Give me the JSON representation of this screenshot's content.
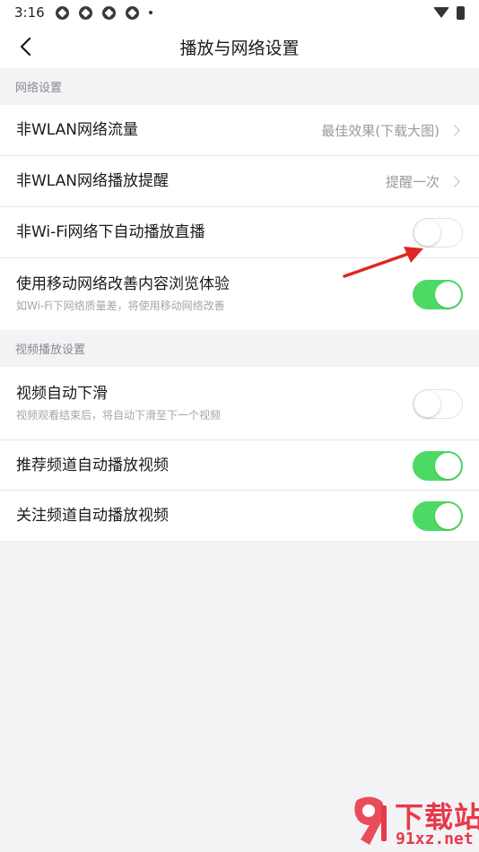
{
  "status_bar": {
    "time": "3:16"
  },
  "header": {
    "title": "播放与网络设置"
  },
  "network_section": {
    "heading": "网络设置",
    "items": [
      {
        "label": "非WLAN网络流量",
        "value": "最佳效果(下载大图)"
      },
      {
        "label": "非WLAN网络播放提醒",
        "value": "提醒一次"
      },
      {
        "label": "非Wi-Fi网络下自动播放直播",
        "toggle": false
      },
      {
        "label": "使用移动网络改善内容浏览体验",
        "sub": "如Wi-Fi下网络质量差，将使用移动网络改善",
        "toggle": true
      }
    ]
  },
  "video_section": {
    "heading": "视频播放设置",
    "items": [
      {
        "label": "视频自动下滑",
        "sub": "视频观看结束后，将自动下滑至下一个视频",
        "toggle": false
      },
      {
        "label": "推荐频道自动播放视频",
        "toggle": true
      },
      {
        "label": "关注频道自动播放视频",
        "toggle": true
      }
    ]
  },
  "watermark": {
    "brand": "下载站",
    "url": "91xz.net",
    "logo_text": "91"
  },
  "colors": {
    "toggle_on": "#4cd964",
    "arrow": "#e0261f",
    "watermark": "#e83a4a"
  },
  "icons": [
    "back-chevron-icon",
    "chevron-right-icon",
    "wifi-icon",
    "battery-icon",
    "notification-icon"
  ]
}
